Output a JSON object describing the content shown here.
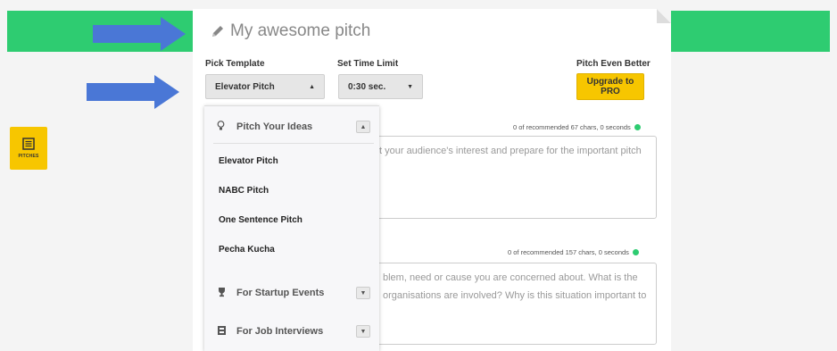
{
  "colors": {
    "brand_green": "#2ecc71",
    "accent_yellow": "#f7c600",
    "annotation_arrow": "#4a77d6"
  },
  "sidebar": {
    "pitches_label": "PITCHES",
    "pitches_icon": "document-list-icon"
  },
  "header": {
    "title": "My awesome pitch",
    "title_icon": "pencil-icon"
  },
  "controls": {
    "template_label": "Pick Template",
    "template_value": "Elevator Pitch",
    "time_label": "Set Time Limit",
    "time_value": "0:30 sec.",
    "better_label": "Pitch Even Better",
    "upgrade_label": "Upgrade to PRO"
  },
  "sections": [
    {
      "counter": "0 of recommended 67 chars, 0 seconds",
      "placeholder_visible": "t your audience's interest and prepare for the important pitch"
    },
    {
      "counter": "0 of recommended 157 chars, 0 seconds",
      "placeholder_line1": "blem, need or cause you are concerned about. What is the",
      "placeholder_line2": "organisations are involved? Why is this situation important to"
    }
  ],
  "dropdown": {
    "groups": [
      {
        "label": "Pitch Your Ideas",
        "icon": "lightbulb-icon",
        "expanded": true
      },
      {
        "label": "For Startup Events",
        "icon": "trophy-icon",
        "expanded": false
      },
      {
        "label": "For Job Interviews",
        "icon": "briefcase-icon",
        "expanded": false
      }
    ],
    "items": [
      "Elevator Pitch",
      "NABC Pitch",
      "One Sentence Pitch",
      "Pecha Kucha"
    ]
  }
}
